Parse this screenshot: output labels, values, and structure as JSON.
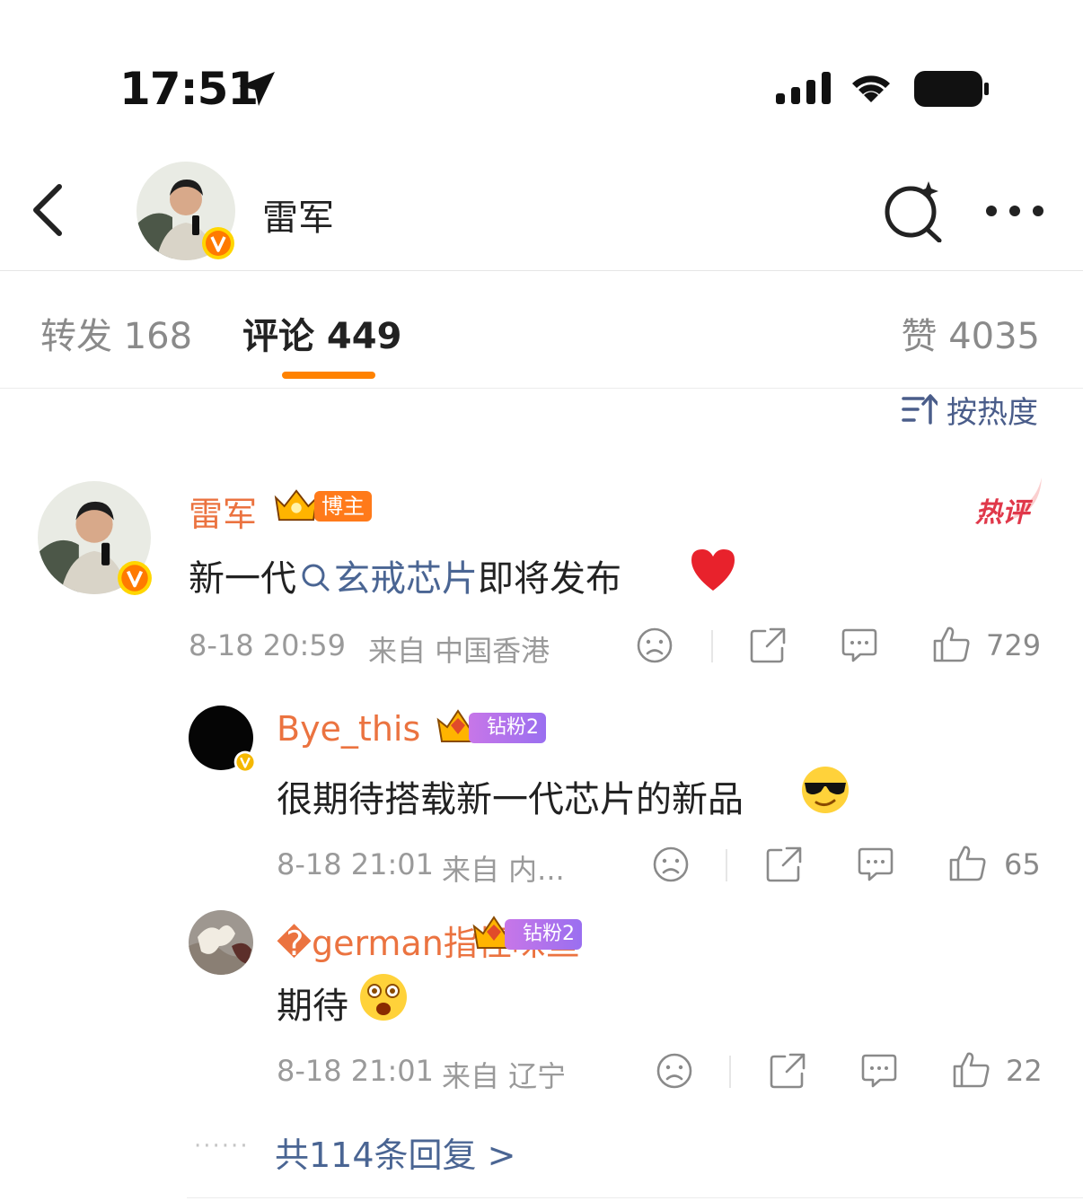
{
  "status_bar": {
    "time": "17:51"
  },
  "nav": {
    "title": "雷军"
  },
  "tabs": [
    {
      "label": "转发 168"
    },
    {
      "label": "评论 449"
    },
    {
      "label": "赞 4035"
    }
  ],
  "sort": {
    "label": "按热度"
  },
  "comments": [
    {
      "user": "雷军",
      "badge": "博主",
      "hot_tag": "热评",
      "text_before": "新一代",
      "topic": "玄戒芯片",
      "text_after": "即将发布",
      "emoji": "❤️",
      "time": "8-18 20:59",
      "source": "来自 中国香港",
      "likes": "729"
    },
    {
      "user": "Bye_this",
      "fan_level": "钻粉2",
      "text": "很期待搭载新一代芯片的新品",
      "time": "8-18 21:01",
      "source": "来自 内...",
      "likes": "65"
    },
    {
      "user": "�german指怪味鱼",
      "fan_level": "钻粉2",
      "text": "期待",
      "time": "8-18 21:01",
      "source": "来自 辽宁",
      "likes": "22"
    }
  ],
  "more_replies": "共114条回复 >"
}
